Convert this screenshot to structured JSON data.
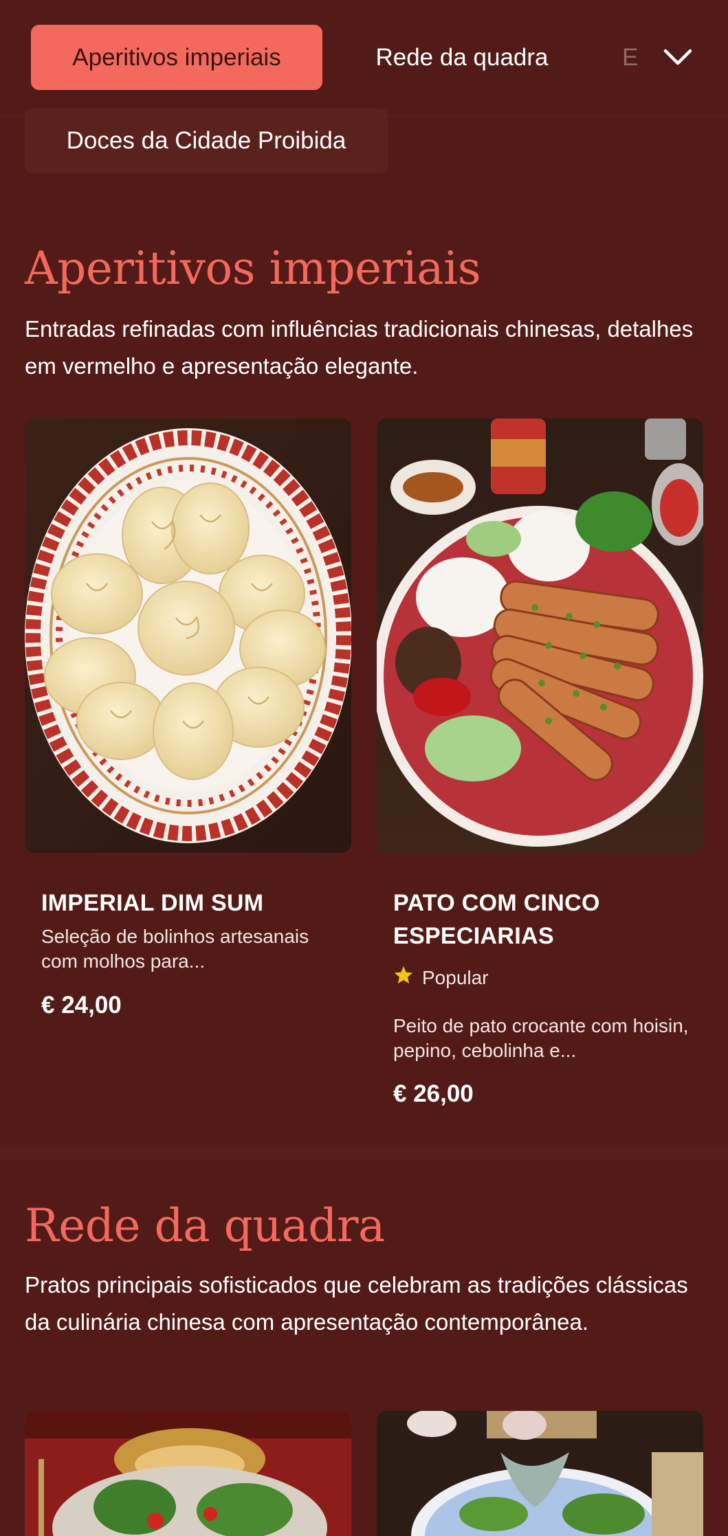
{
  "nav": {
    "tabs": [
      {
        "label": "Aperitivos imperiais"
      },
      {
        "label": "Rede da quadra"
      },
      {
        "label": "E"
      },
      {
        "label": "Doces da Cidade Proibida"
      }
    ],
    "expand_icon": "chevron-down-icon"
  },
  "sections": [
    {
      "title": "Aperitivos imperiais",
      "description": "Entradas refinadas com influências tradicionais chinesas, detalhes em vermelho e apresentação elegante.",
      "dishes": [
        {
          "name": "IMPERIAL DIM SUM",
          "description": "Seleção de bolinhos artesanais com molhos para...",
          "price": "€ 24,00"
        },
        {
          "name": "PATO COM CINCO ESPECIARIAS",
          "badge": "Popular",
          "badge_icon": "star-icon",
          "description": "Peito de pato crocante com hoisin, pepino, cebolinha e...",
          "price": "€ 26,00"
        }
      ]
    },
    {
      "title": "Rede da quadra",
      "description": "Pratos principais sofisticados que celebram as tradições clássicas da culinária chinesa com apresentação contemporânea."
    }
  ],
  "colors": {
    "background": "#521b18",
    "accent": "#f3695d",
    "star": "#f5c518"
  }
}
